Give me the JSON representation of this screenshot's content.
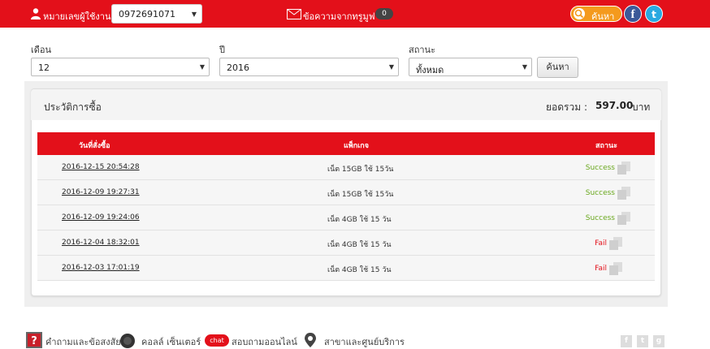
{
  "header": {
    "user_label": "หมายเลขผู้ใช้งาน",
    "phone_number": "0972691071",
    "messages_label": "ข้อความจากทรูมูฟ",
    "messages_count": "0",
    "search_label": "ค้นหา",
    "facebook_letter": "f",
    "twitter_letter": "t"
  },
  "filters": {
    "month_label": "เดือน",
    "month_value": "12",
    "year_label": "ปี",
    "year_value": "2016",
    "status_label": "สถานะ",
    "status_value": "ทั้งหมด",
    "search_button": "ค้นหา"
  },
  "panel": {
    "title": "ประวัติการซื้อ",
    "total_label": "ยอดรวม :",
    "total_value": "597.00",
    "total_unit": "บาท"
  },
  "table": {
    "headers": [
      "วันที่สั่งซื้อ",
      "แพ็กเกจ",
      "สถานะ"
    ],
    "rows": [
      {
        "date": "2016-12-15 20:54:28",
        "package": "เน็ต 15GB ใช้ 15วัน",
        "status": "Success"
      },
      {
        "date": "2016-12-09 19:27:31",
        "package": "เน็ต 15GB ใช้ 15วัน",
        "status": "Success"
      },
      {
        "date": "2016-12-09 19:24:06",
        "package": "เน็ต 4GB ใช้ 15 วัน",
        "status": "Success"
      },
      {
        "date": "2016-12-04 18:32:01",
        "package": "เน็ต 4GB ใช้ 15 วัน",
        "status": "Fail"
      },
      {
        "date": "2016-12-03 17:01:19",
        "package": "เน็ต 4GB ใช้ 15 วัน",
        "status": "Fail"
      }
    ]
  },
  "footer": {
    "faq": "คำถามและข้อสงสัย",
    "call_center": "คอลล์ เซ็นเตอร์",
    "chat_badge": "chat",
    "chat_online": "สอบถามออนไลน์",
    "branches": "สาขาและศูนย์บริการ",
    "social_letters": [
      "f",
      "t",
      "g"
    ]
  },
  "colors": {
    "brand_red": "#e3101a",
    "success": "#6aa81e",
    "fail": "#e3101a",
    "search_orange": "#f49a1d"
  }
}
